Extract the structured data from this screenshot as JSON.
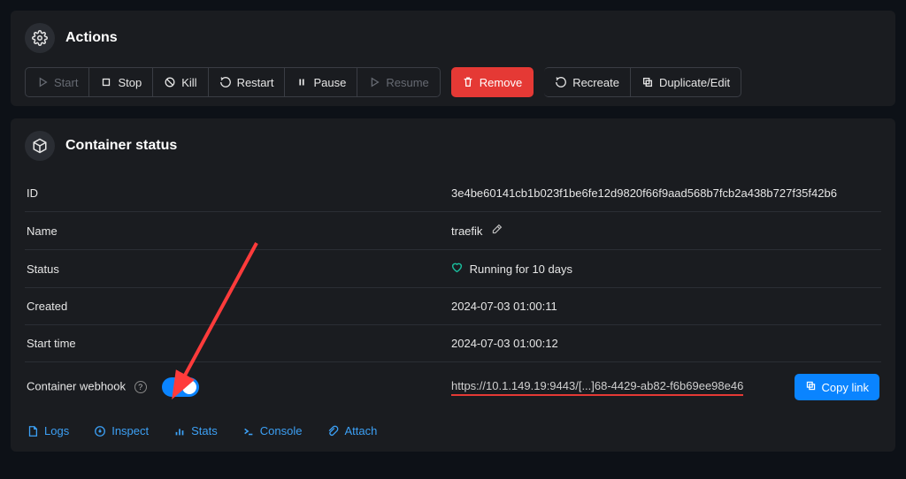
{
  "actions": {
    "title": "Actions",
    "buttons": {
      "start": "Start",
      "stop": "Stop",
      "kill": "Kill",
      "restart": "Restart",
      "pause": "Pause",
      "resume": "Resume",
      "remove": "Remove",
      "recreate": "Recreate",
      "duplicate": "Duplicate/Edit"
    }
  },
  "status": {
    "title": "Container status",
    "labels": {
      "id": "ID",
      "name": "Name",
      "status": "Status",
      "created": "Created",
      "start_time": "Start time",
      "webhook": "Container webhook"
    },
    "values": {
      "id": "3e4be60141cb1b023f1be6fe12d9820f66f9aad568b7fcb2a438b727f35f42b6",
      "name": "traefik",
      "running_text": "Running for 10 days",
      "created": "2024-07-03 01:00:11",
      "start_time": "2024-07-03 01:00:12",
      "webhook_url": "https://10.1.149.19:9443/[...]68-4429-ab82-f6b69ee98e46",
      "copy_label": "Copy link"
    }
  },
  "footer": {
    "logs": "Logs",
    "inspect": "Inspect",
    "stats": "Stats",
    "console": "Console",
    "attach": "Attach"
  }
}
